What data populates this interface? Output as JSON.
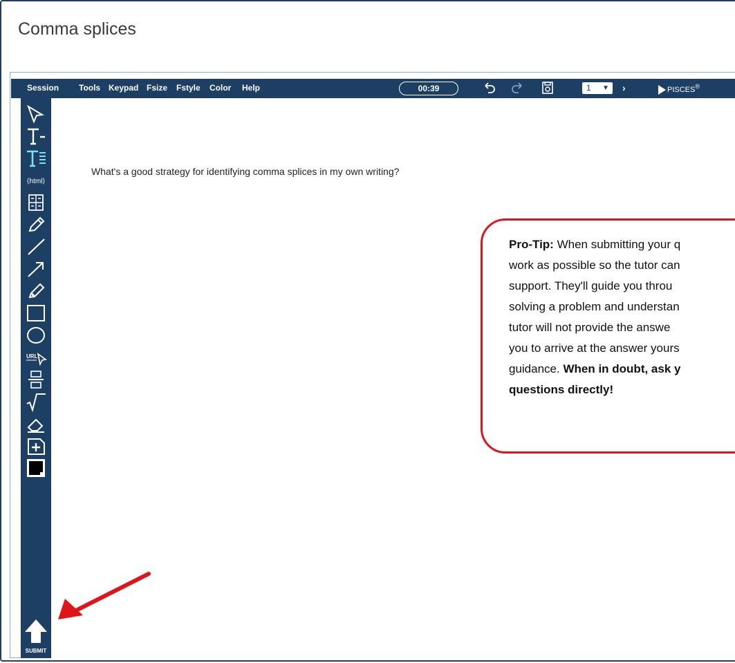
{
  "page": {
    "title": "Comma splices"
  },
  "menubar": {
    "items": [
      "Session",
      "Tools",
      "Keypad",
      "Fsize",
      "Fstyle",
      "Color",
      "Help"
    ],
    "timer": "00:39",
    "page_select": "1",
    "brand": "PISCES",
    "brand_mark": "®"
  },
  "icons": {
    "undo": "undo-icon",
    "redo": "redo-icon",
    "save": "save-icon",
    "next": "next-page-icon"
  },
  "sidebar": {
    "tools": [
      {
        "name": "select-tool"
      },
      {
        "name": "text-tool"
      },
      {
        "name": "text-box-tool"
      },
      {
        "name": "html-tool",
        "label": "⟨html⟩"
      },
      {
        "name": "keypad-tool"
      },
      {
        "name": "pencil-tool"
      },
      {
        "name": "line-tool"
      },
      {
        "name": "arrow-tool"
      },
      {
        "name": "highlighter-tool"
      },
      {
        "name": "rectangle-tool"
      },
      {
        "name": "ellipse-tool"
      },
      {
        "name": "url-tool",
        "label": "URL"
      },
      {
        "name": "fraction-tool"
      },
      {
        "name": "sqrt-tool"
      },
      {
        "name": "eraser-tool"
      },
      {
        "name": "add-page-tool"
      },
      {
        "name": "color-tool"
      }
    ],
    "submit_label": "SUBMIT"
  },
  "content": {
    "question": "What's a good strategy for identifying comma splices in my own writing?"
  },
  "protip": {
    "label": "Pro-Tip:",
    "line1_rest": " When submitting your q",
    "line2": "work as possible so the tutor can",
    "line3": "support.  They'll guide you throu",
    "line4": "solving a problem and understan",
    "line5": "tutor will not provide the answe",
    "line6": "you to arrive at the answer yours",
    "line7_plain": "guidance.  ",
    "line7_bold": "When in doubt, ask y",
    "line8_bold": "questions directly!"
  },
  "colors": {
    "toolbar": "#1c3f63",
    "protip_border": "#e0141b",
    "annotation_arrow": "#e0141b"
  }
}
